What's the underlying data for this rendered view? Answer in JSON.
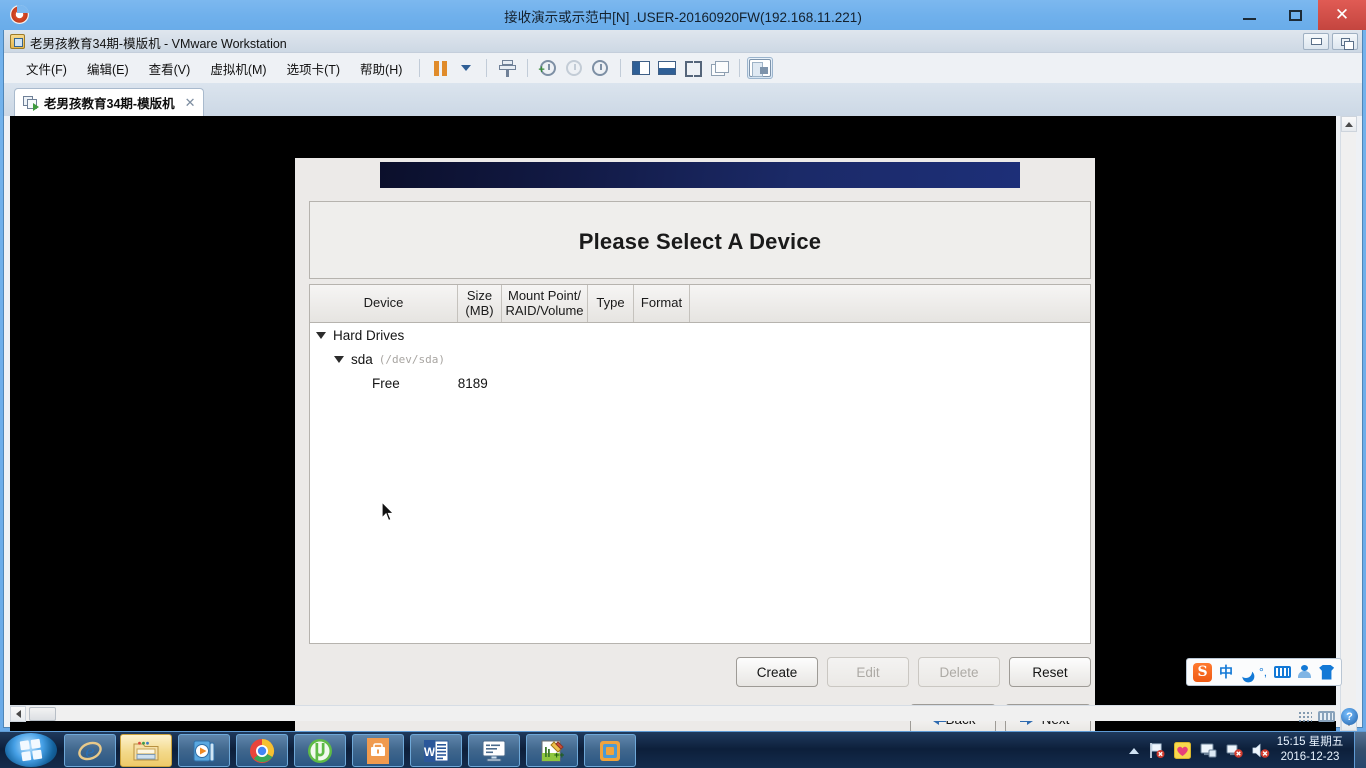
{
  "session_window": {
    "title": "接收演示或示范中[N] .USER-20160920FW(192.168.11.221)",
    "logo_icon": "teamviewer-logo-icon",
    "minimize_label": "",
    "maximize_label": "",
    "close_label": "✕"
  },
  "vmware": {
    "title": "老男孩教育34期-模版机 - VMware Workstation",
    "app_icon": "vmware-window-icon",
    "menu": [
      {
        "label": "文件(F)",
        "name": "menu-file"
      },
      {
        "label": "编辑(E)",
        "name": "menu-edit"
      },
      {
        "label": "查看(V)",
        "name": "menu-view"
      },
      {
        "label": "虚拟机(M)",
        "name": "menu-vm"
      },
      {
        "label": "选项卡(T)",
        "name": "menu-tabs"
      },
      {
        "label": "帮助(H)",
        "name": "menu-help"
      }
    ],
    "toolbar_icons": [
      "pause-icon",
      "dropdown-caret-icon",
      "snapshot-icon",
      "take-snapshot-icon",
      "revert-snapshot-icon",
      "manage-snapshots-icon",
      "show-sidebar-icon",
      "show-console-icon",
      "fullscreen-icon",
      "multiple-monitors-icon",
      "show-panel-icon"
    ],
    "tab": {
      "label": "老男孩教育34期-模版机",
      "icon": "vm-tab-icon",
      "close_label": "✕"
    },
    "title_buttons": [
      "restore-down-icon",
      "maximize-window-icon"
    ]
  },
  "installer": {
    "banner_icon": "anaconda-banner",
    "heading": "Please Select A Device",
    "table": {
      "columns": [
        {
          "label": "Device",
          "name": "column-device"
        },
        {
          "label": "Size\n(MB)",
          "line1": "Size",
          "line2": "(MB)",
          "name": "column-size"
        },
        {
          "label": "Mount Point/ RAID/Volume",
          "line1": "Mount Point/",
          "line2": "RAID/Volume",
          "name": "column-mount-point"
        },
        {
          "label": "Type",
          "name": "column-type"
        },
        {
          "label": "Format",
          "name": "column-format"
        }
      ],
      "rows": [
        {
          "level": 0,
          "expander": "▽",
          "name": "Hard Drives",
          "path": "",
          "size": "",
          "mount": "",
          "type": "",
          "format": ""
        },
        {
          "level": 1,
          "expander": "▽",
          "name": "sda",
          "path": "(/dev/sda)",
          "size": "",
          "mount": "",
          "type": "",
          "format": ""
        },
        {
          "level": 2,
          "expander": "",
          "name": "Free",
          "path": "",
          "size": "8189",
          "mount": "",
          "type": "",
          "format": ""
        }
      ]
    },
    "action_buttons": [
      {
        "label": "Create",
        "enabled": true,
        "name": "create-button"
      },
      {
        "label": "Edit",
        "enabled": false,
        "name": "edit-button"
      },
      {
        "label": "Delete",
        "enabled": false,
        "name": "delete-button"
      },
      {
        "label": "Reset",
        "enabled": true,
        "name": "reset-button"
      }
    ],
    "nav_buttons": [
      {
        "label": "Back",
        "icon": "arrow-left-icon",
        "name": "back-button"
      },
      {
        "label": "Next",
        "icon": "arrow-right-icon",
        "name": "next-button"
      }
    ]
  },
  "sogou_ime": {
    "logo": "S",
    "mode": "中",
    "items": [
      "sogou-logo-icon",
      "chinese-mode-icon",
      "moon-icon",
      "punctuation-icon",
      "soft-keyboard-icon",
      "user-icon",
      "skin-icon"
    ]
  },
  "taskbar": {
    "start_label": "",
    "buttons": [
      {
        "name": "taskbar-internet-explorer",
        "icon": "internet-explorer-icon",
        "active": false
      },
      {
        "name": "taskbar-file-explorer",
        "icon": "file-explorer-icon",
        "active": true
      },
      {
        "name": "taskbar-media-player",
        "icon": "media-player-icon",
        "active": false
      },
      {
        "name": "taskbar-chrome",
        "icon": "chrome-icon",
        "active": false
      },
      {
        "name": "taskbar-utorrent",
        "icon": "utorrent-icon",
        "active": false
      },
      {
        "name": "taskbar-toolbox",
        "icon": "toolbox-icon",
        "active": false
      },
      {
        "name": "taskbar-word",
        "icon": "word-icon",
        "active": false
      },
      {
        "name": "taskbar-xshell",
        "icon": "terminal-icon",
        "active": false
      },
      {
        "name": "taskbar-notepadpp",
        "icon": "notepad-plus-plus-icon",
        "active": false
      },
      {
        "name": "taskbar-vmware",
        "icon": "vmware-icon",
        "active": false
      }
    ],
    "tray_icons": [
      "show-hidden-icons-arrow",
      "flag-action-center-icon",
      "heart-icon",
      "network-icon",
      "usb-eject-icon",
      "volume-muted-icon"
    ],
    "clock": {
      "time": "15:15 星期五",
      "date": "2016-12-23"
    }
  },
  "vm_status_icons": [
    "numpad-icon",
    "keyboard-icon",
    "help-icon"
  ],
  "colors": {
    "session_blue": "#6fb0ec",
    "close_red": "#c4453f",
    "banner_navy": "#1d2f78",
    "dialog_gray": "#eceae8",
    "taskbar_navy": "#0d203c",
    "sogou_blue": "#1379d6",
    "accent_arrow": "#2f6bb0"
  }
}
